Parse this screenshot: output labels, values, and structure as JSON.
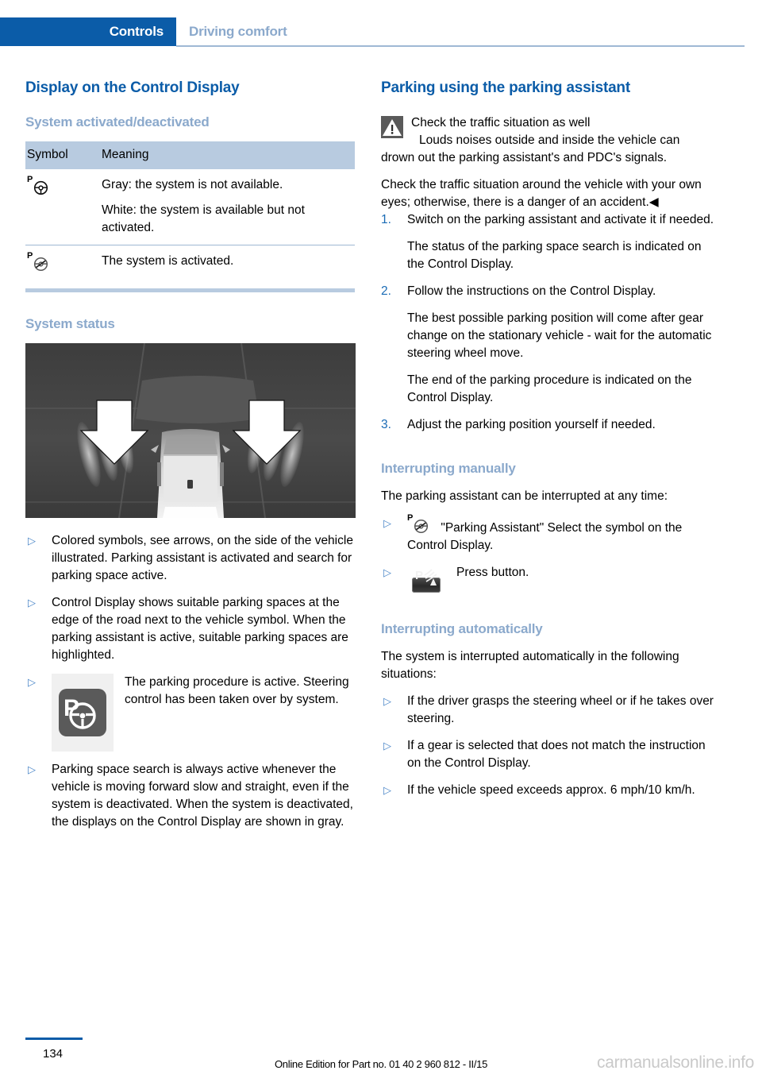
{
  "header": {
    "active_tab": "Controls",
    "inactive_tab": "Driving comfort",
    "accent_color": "#0b5ca8",
    "muted_color": "#8ba9cc"
  },
  "left": {
    "title": "Display on the Control Display",
    "subtitle_1": "System activated/deactivated",
    "table": {
      "headers": [
        "Symbol",
        "Meaning"
      ],
      "rows": [
        {
          "symbol": "parking-assistant-wheel-icon",
          "lines": [
            "Gray: the system is not available.",
            "White: the system is available but not activated."
          ]
        },
        {
          "symbol": "parking-assistant-wheel-active-icon",
          "lines": [
            "The system is activated."
          ]
        }
      ]
    },
    "subtitle_2": "System status",
    "figure_caption": "overhead-view-vehicle-parking-sensors",
    "bullets": [
      "Colored symbols, see arrows, on the side of the vehicle illustrated. Parking assistant is activated and search for parking space active.",
      "Control Display shows suitable parking spaces at the edge of the road next to the vehicle symbol. When the parking assistant is active, suitable parking spaces are highlighted.",
      "The parking procedure is active. Steering control has been taken over by system.",
      "Parking space search is always active whenever the vehicle is moving forward slow and straight, even if the system is deactivated. When the system is deactivated, the displays on the Control Display are shown in gray."
    ]
  },
  "right": {
    "title": "Parking using the parking assistant",
    "warning": {
      "icon": "warning-triangle-icon",
      "heading": "Check the traffic situation as well",
      "body": "Louds noises outside and inside the vehicle can drown out the parking assistant's and PDC's signals.",
      "closing": "Check the traffic situation around the vehicle with your own eyes; otherwise, there is a danger of an accident.◀"
    },
    "steps": [
      {
        "number": "1.",
        "text": "Switch on the parking assistant and activate it if needed.",
        "notes": [
          "The status of the parking space search is indicated on the Control Display."
        ]
      },
      {
        "number": "2.",
        "text": "Follow the instructions on the Control Display.",
        "notes": [
          "The best possible parking position will come after gear change on the stationary vehicle - wait for the automatic steering wheel move.",
          "The end of the parking procedure is indicated on the Control Display."
        ]
      },
      {
        "number": "3.",
        "text": "Adjust the parking position yourself if needed.",
        "notes": []
      }
    ],
    "subtitle_manual": "Interrupting manually",
    "manual_intro": "The parking assistant can be interrupted at any time:",
    "manual_bullets": [
      "\"Parking Assistant\" Select the symbol on the Control Display.",
      "Press button."
    ],
    "subtitle_auto": "Interrupting automatically",
    "auto_intro": "The system is interrupted automatically in the following situations:",
    "auto_bullets": [
      "If the driver grasps the steering wheel or if he takes over steering.",
      "If a gear is selected that does not match the instruction on the Control Display.",
      "If the vehicle speed exceeds approx. 6 mph/10 km/h."
    ]
  },
  "footer": {
    "page_number": "134",
    "edition_text": "Online Edition for Part no. 01 40 2 960 812 - II/15",
    "watermark": "carmanualsonline.info"
  }
}
